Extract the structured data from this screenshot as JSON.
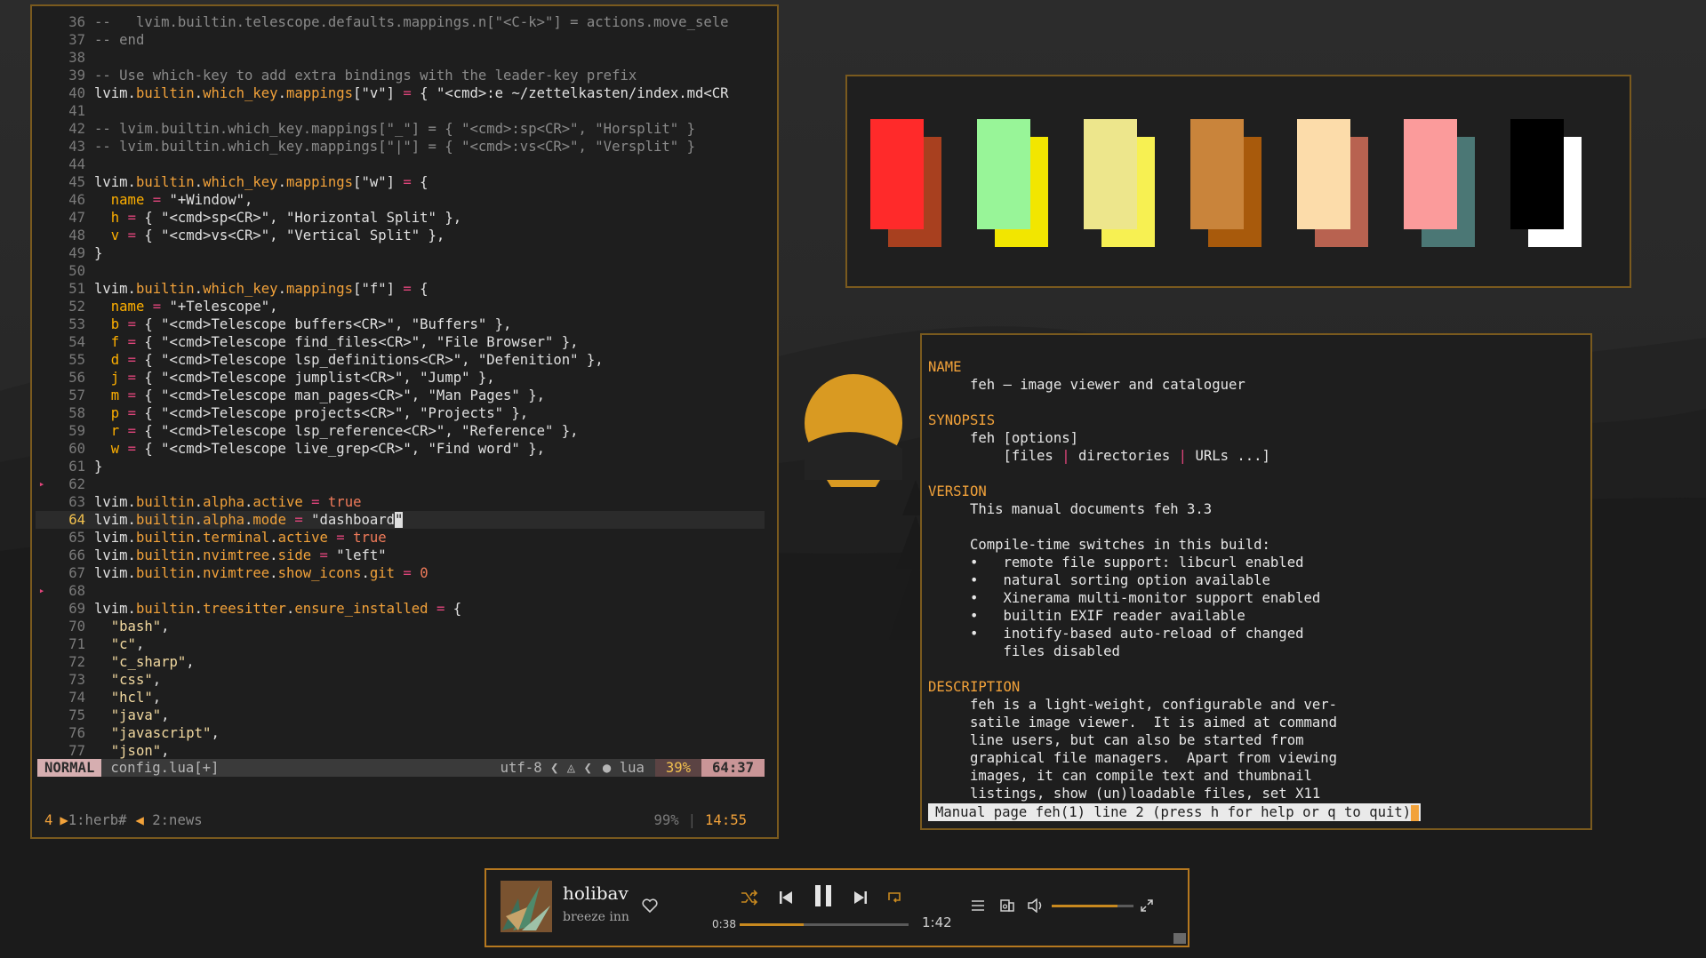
{
  "editor": {
    "lines": [
      {
        "n": "36",
        "parts": [
          [
            "g",
            "--   lvim.builtin.telescope.defaults.mappings.n[\"<C-k>\"] = actions.move_sele"
          ]
        ]
      },
      {
        "n": "37",
        "parts": [
          [
            "g",
            "-- end"
          ]
        ]
      },
      {
        "n": "38",
        "parts": []
      },
      {
        "n": "39",
        "parts": [
          [
            "g",
            "-- Use which-key to add extra bindings with the leader-key prefix"
          ]
        ]
      },
      {
        "n": "40",
        "parts": [
          [
            "t",
            "lvim."
          ],
          [
            "f",
            "builtin"
          ],
          [
            "t",
            "."
          ],
          [
            "f",
            "which_key"
          ],
          [
            "t",
            "."
          ],
          [
            "f",
            "mappings"
          ],
          [
            "t",
            "[\"v\"] "
          ],
          [
            "o",
            "="
          ],
          [
            "t",
            " { \"<cmd>:e ~/zettelkasten/index.md<CR"
          ]
        ]
      },
      {
        "n": "41",
        "parts": []
      },
      {
        "n": "42",
        "parts": [
          [
            "g",
            "-- lvim.builtin.which_key.mappings[\"_\"] = { \"<cmd>:sp<CR>\", \"Horsplit\" }"
          ]
        ]
      },
      {
        "n": "43",
        "parts": [
          [
            "g",
            "-- lvim.builtin.which_key.mappings[\"|\"] = { \"<cmd>:vs<CR>\", \"Versplit\" }"
          ]
        ]
      },
      {
        "n": "44",
        "parts": []
      },
      {
        "n": "45",
        "parts": [
          [
            "t",
            "lvim."
          ],
          [
            "f",
            "builtin"
          ],
          [
            "t",
            "."
          ],
          [
            "f",
            "which_key"
          ],
          [
            "t",
            "."
          ],
          [
            "f",
            "mappings"
          ],
          [
            "t",
            "[\"w\"] "
          ],
          [
            "o",
            "="
          ],
          [
            "t",
            " {"
          ]
        ]
      },
      {
        "n": "46",
        "parts": [
          [
            "t",
            "  "
          ],
          [
            "k",
            "name"
          ],
          [
            "t",
            " "
          ],
          [
            "o",
            "="
          ],
          [
            "t",
            " \"+Window\","
          ]
        ]
      },
      {
        "n": "47",
        "parts": [
          [
            "t",
            "  "
          ],
          [
            "k",
            "h"
          ],
          [
            "t",
            " "
          ],
          [
            "o",
            "="
          ],
          [
            "t",
            " { \"<cmd>sp<CR>\", \"Horizontal Split\" },"
          ]
        ]
      },
      {
        "n": "48",
        "parts": [
          [
            "t",
            "  "
          ],
          [
            "k",
            "v"
          ],
          [
            "t",
            " "
          ],
          [
            "o",
            "="
          ],
          [
            "t",
            " { \"<cmd>vs<CR>\", \"Vertical Split\" },"
          ]
        ]
      },
      {
        "n": "49",
        "parts": [
          [
            "t",
            "}"
          ]
        ]
      },
      {
        "n": "50",
        "parts": []
      },
      {
        "n": "51",
        "parts": [
          [
            "t",
            "lvim."
          ],
          [
            "f",
            "builtin"
          ],
          [
            "t",
            "."
          ],
          [
            "f",
            "which_key"
          ],
          [
            "t",
            "."
          ],
          [
            "f",
            "mappings"
          ],
          [
            "t",
            "[\"f\"] "
          ],
          [
            "o",
            "="
          ],
          [
            "t",
            " {"
          ]
        ]
      },
      {
        "n": "52",
        "parts": [
          [
            "t",
            "  "
          ],
          [
            "k",
            "name"
          ],
          [
            "t",
            " "
          ],
          [
            "o",
            "="
          ],
          [
            "t",
            " \"+Telescope\","
          ]
        ]
      },
      {
        "n": "53",
        "parts": [
          [
            "t",
            "  "
          ],
          [
            "k",
            "b"
          ],
          [
            "t",
            " "
          ],
          [
            "o",
            "="
          ],
          [
            "t",
            " { \"<cmd>Telescope buffers<CR>\", \"Buffers\" },"
          ]
        ]
      },
      {
        "n": "54",
        "parts": [
          [
            "t",
            "  "
          ],
          [
            "k",
            "f"
          ],
          [
            "t",
            " "
          ],
          [
            "o",
            "="
          ],
          [
            "t",
            " { \"<cmd>Telescope find_files<CR>\", \"File Browser\" },"
          ]
        ]
      },
      {
        "n": "55",
        "parts": [
          [
            "t",
            "  "
          ],
          [
            "k",
            "d"
          ],
          [
            "t",
            " "
          ],
          [
            "o",
            "="
          ],
          [
            "t",
            " { \"<cmd>Telescope lsp_definitions<CR>\", \"Defenition\" },"
          ]
        ]
      },
      {
        "n": "56",
        "parts": [
          [
            "t",
            "  "
          ],
          [
            "k",
            "j"
          ],
          [
            "t",
            " "
          ],
          [
            "o",
            "="
          ],
          [
            "t",
            " { \"<cmd>Telescope jumplist<CR>\", \"Jump\" },"
          ]
        ]
      },
      {
        "n": "57",
        "parts": [
          [
            "t",
            "  "
          ],
          [
            "k",
            "m"
          ],
          [
            "t",
            " "
          ],
          [
            "o",
            "="
          ],
          [
            "t",
            " { \"<cmd>Telescope man_pages<CR>\", \"Man Pages\" },"
          ]
        ]
      },
      {
        "n": "58",
        "parts": [
          [
            "t",
            "  "
          ],
          [
            "k",
            "p"
          ],
          [
            "t",
            " "
          ],
          [
            "o",
            "="
          ],
          [
            "t",
            " { \"<cmd>Telescope projects<CR>\", \"Projects\" },"
          ]
        ]
      },
      {
        "n": "59",
        "parts": [
          [
            "t",
            "  "
          ],
          [
            "k",
            "r"
          ],
          [
            "t",
            " "
          ],
          [
            "o",
            "="
          ],
          [
            "t",
            " { \"<cmd>Telescope lsp_reference<CR>\", \"Reference\" },"
          ]
        ]
      },
      {
        "n": "60",
        "parts": [
          [
            "t",
            "  "
          ],
          [
            "k",
            "w"
          ],
          [
            "t",
            " "
          ],
          [
            "o",
            "="
          ],
          [
            "t",
            " { \"<cmd>Telescope live_grep<CR>\", \"Find word\" },"
          ]
        ]
      },
      {
        "n": "61",
        "parts": [
          [
            "t",
            "}"
          ]
        ]
      },
      {
        "n": "62",
        "sign": "▸",
        "parts": []
      },
      {
        "n": "63",
        "parts": [
          [
            "t",
            "lvim."
          ],
          [
            "f",
            "builtin"
          ],
          [
            "t",
            "."
          ],
          [
            "f",
            "alpha"
          ],
          [
            "t",
            "."
          ],
          [
            "f",
            "active"
          ],
          [
            "t",
            " "
          ],
          [
            "o",
            "="
          ],
          [
            "t",
            " "
          ],
          [
            "b",
            "true"
          ]
        ]
      },
      {
        "n": "64",
        "current": true,
        "parts": [
          [
            "t",
            "lvim."
          ],
          [
            "f",
            "builtin"
          ],
          [
            "t",
            "."
          ],
          [
            "f",
            "alpha"
          ],
          [
            "t",
            "."
          ],
          [
            "f",
            "mode"
          ],
          [
            "t",
            " "
          ],
          [
            "o",
            "="
          ],
          [
            "t",
            " \"dashboard"
          ],
          [
            "c",
            "\""
          ]
        ]
      },
      {
        "n": "65",
        "parts": [
          [
            "t",
            "lvim."
          ],
          [
            "f",
            "builtin"
          ],
          [
            "t",
            "."
          ],
          [
            "f",
            "terminal"
          ],
          [
            "t",
            "."
          ],
          [
            "f",
            "active"
          ],
          [
            "t",
            " "
          ],
          [
            "o",
            "="
          ],
          [
            "t",
            " "
          ],
          [
            "b",
            "true"
          ]
        ]
      },
      {
        "n": "66",
        "parts": [
          [
            "t",
            "lvim."
          ],
          [
            "f",
            "builtin"
          ],
          [
            "t",
            "."
          ],
          [
            "f",
            "nvimtree"
          ],
          [
            "t",
            "."
          ],
          [
            "f",
            "side"
          ],
          [
            "t",
            " "
          ],
          [
            "o",
            "="
          ],
          [
            "t",
            " \"left\""
          ]
        ]
      },
      {
        "n": "67",
        "parts": [
          [
            "t",
            "lvim."
          ],
          [
            "f",
            "builtin"
          ],
          [
            "t",
            "."
          ],
          [
            "f",
            "nvimtree"
          ],
          [
            "t",
            "."
          ],
          [
            "f",
            "show_icons"
          ],
          [
            "t",
            "."
          ],
          [
            "f",
            "git"
          ],
          [
            "t",
            " "
          ],
          [
            "o",
            "="
          ],
          [
            "t",
            " "
          ],
          [
            "b",
            "0"
          ]
        ]
      },
      {
        "n": "68",
        "sign": "▸",
        "parts": []
      },
      {
        "n": "69",
        "parts": [
          [
            "t",
            "lvim."
          ],
          [
            "f",
            "builtin"
          ],
          [
            "t",
            "."
          ],
          [
            "f",
            "treesitter"
          ],
          [
            "t",
            "."
          ],
          [
            "f",
            "ensure_installed"
          ],
          [
            "t",
            " "
          ],
          [
            "o",
            "="
          ],
          [
            "t",
            " {"
          ]
        ]
      },
      {
        "n": "70",
        "parts": [
          [
            "t",
            "  "
          ],
          [
            "s",
            "\"bash\""
          ],
          [
            "t",
            ","
          ]
        ]
      },
      {
        "n": "71",
        "parts": [
          [
            "t",
            "  "
          ],
          [
            "s",
            "\"c\""
          ],
          [
            "t",
            ","
          ]
        ]
      },
      {
        "n": "72",
        "parts": [
          [
            "t",
            "  "
          ],
          [
            "s",
            "\"c_sharp\""
          ],
          [
            "t",
            ","
          ]
        ]
      },
      {
        "n": "73",
        "parts": [
          [
            "t",
            "  "
          ],
          [
            "s",
            "\"css\""
          ],
          [
            "t",
            ","
          ]
        ]
      },
      {
        "n": "74",
        "parts": [
          [
            "t",
            "  "
          ],
          [
            "s",
            "\"hcl\""
          ],
          [
            "t",
            ","
          ]
        ]
      },
      {
        "n": "75",
        "parts": [
          [
            "t",
            "  "
          ],
          [
            "s",
            "\"java\""
          ],
          [
            "t",
            ","
          ]
        ]
      },
      {
        "n": "76",
        "parts": [
          [
            "t",
            "  "
          ],
          [
            "s",
            "\"javascript\""
          ],
          [
            "t",
            ","
          ]
        ]
      },
      {
        "n": "77",
        "parts": [
          [
            "t",
            "  "
          ],
          [
            "s",
            "\"json\""
          ],
          [
            "t",
            ","
          ]
        ]
      }
    ],
    "status": {
      "mode": "NORMAL",
      "file": "config.lua[+]",
      "encoding": "utf-8 ❮ ◬ ❮",
      "filetype": "● lua",
      "percent": "39%",
      "position": "64:37"
    },
    "tmux": {
      "session": "4",
      "win1": "1:herb#",
      "win2": "2:news",
      "percent": "99%",
      "sep": "|",
      "time": "14:55"
    }
  },
  "palette": {
    "swatches": [
      {
        "front": "#ff2a2a",
        "back": "#a8401f"
      },
      {
        "front": "#98f598",
        "back": "#f2e600"
      },
      {
        "front": "#ede68c",
        "back": "#f7f052"
      },
      {
        "front": "#c9843b",
        "back": "#a85a0c"
      },
      {
        "front": "#fcdcaa",
        "back": "#b86250"
      },
      {
        "front": "#fb9b9b",
        "back": "#4b7775"
      },
      {
        "front": "#000000",
        "back": "#ffffff"
      }
    ]
  },
  "manpage": {
    "lines": [
      {
        "h": true,
        "t": "NAME"
      },
      {
        "t": "     feh – image viewer and cataloguer"
      },
      {
        "t": ""
      },
      {
        "h": true,
        "t": "SYNOPSIS"
      },
      {
        "t": "     feh [options]"
      },
      {
        "pipes": true,
        "t": [
          "         [files ",
          "|",
          " directories ",
          "|",
          " URLs ...]"
        ]
      },
      {
        "t": ""
      },
      {
        "h": true,
        "t": "VERSION"
      },
      {
        "t": "     This manual documents feh 3.3"
      },
      {
        "t": ""
      },
      {
        "t": "     Compile-time switches in this build:"
      },
      {
        "t": "     •   remote file support: libcurl enabled"
      },
      {
        "t": "     •   natural sorting option available"
      },
      {
        "t": "     •   Xinerama multi-monitor support enabled"
      },
      {
        "t": "     •   builtin EXIF reader available"
      },
      {
        "t": "     •   inotify-based auto-reload of changed"
      },
      {
        "t": "         files disabled"
      },
      {
        "t": ""
      },
      {
        "h": true,
        "t": "DESCRIPTION"
      },
      {
        "t": "     feh is a light-weight, configurable and ver-"
      },
      {
        "t": "     satile image viewer.  It is aimed at command"
      },
      {
        "t": "     line users, but can also be started from"
      },
      {
        "t": "     graphical file managers.  Apart from viewing"
      },
      {
        "t": "     images, it can compile text and thumbnail"
      },
      {
        "t": "     listings, show (un)loadable files, set X11"
      }
    ],
    "prompt": "Manual page feh(1) line 2 (press h for help or q to quit)"
  },
  "player": {
    "title": "holibav",
    "artist": "breeze inn",
    "elapsed": "0:38",
    "total": "1:42",
    "progress": 0.38,
    "volume": 0.8,
    "accent": "#c8891f"
  }
}
